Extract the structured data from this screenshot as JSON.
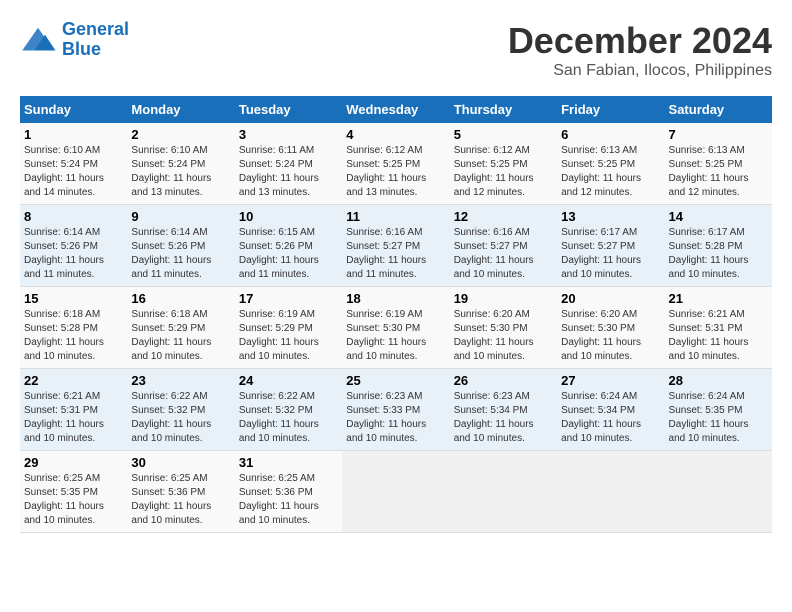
{
  "logo": {
    "line1": "General",
    "line2": "Blue"
  },
  "title": {
    "month": "December 2024",
    "location": "San Fabian, Ilocos, Philippines"
  },
  "headers": [
    "Sunday",
    "Monday",
    "Tuesday",
    "Wednesday",
    "Thursday",
    "Friday",
    "Saturday"
  ],
  "weeks": [
    [
      {
        "day": "1",
        "info": "Sunrise: 6:10 AM\nSunset: 5:24 PM\nDaylight: 11 hours\nand 14 minutes."
      },
      {
        "day": "2",
        "info": "Sunrise: 6:10 AM\nSunset: 5:24 PM\nDaylight: 11 hours\nand 13 minutes."
      },
      {
        "day": "3",
        "info": "Sunrise: 6:11 AM\nSunset: 5:24 PM\nDaylight: 11 hours\nand 13 minutes."
      },
      {
        "day": "4",
        "info": "Sunrise: 6:12 AM\nSunset: 5:25 PM\nDaylight: 11 hours\nand 13 minutes."
      },
      {
        "day": "5",
        "info": "Sunrise: 6:12 AM\nSunset: 5:25 PM\nDaylight: 11 hours\nand 12 minutes."
      },
      {
        "day": "6",
        "info": "Sunrise: 6:13 AM\nSunset: 5:25 PM\nDaylight: 11 hours\nand 12 minutes."
      },
      {
        "day": "7",
        "info": "Sunrise: 6:13 AM\nSunset: 5:25 PM\nDaylight: 11 hours\nand 12 minutes."
      }
    ],
    [
      {
        "day": "8",
        "info": "Sunrise: 6:14 AM\nSunset: 5:26 PM\nDaylight: 11 hours\nand 11 minutes."
      },
      {
        "day": "9",
        "info": "Sunrise: 6:14 AM\nSunset: 5:26 PM\nDaylight: 11 hours\nand 11 minutes."
      },
      {
        "day": "10",
        "info": "Sunrise: 6:15 AM\nSunset: 5:26 PM\nDaylight: 11 hours\nand 11 minutes."
      },
      {
        "day": "11",
        "info": "Sunrise: 6:16 AM\nSunset: 5:27 PM\nDaylight: 11 hours\nand 11 minutes."
      },
      {
        "day": "12",
        "info": "Sunrise: 6:16 AM\nSunset: 5:27 PM\nDaylight: 11 hours\nand 10 minutes."
      },
      {
        "day": "13",
        "info": "Sunrise: 6:17 AM\nSunset: 5:27 PM\nDaylight: 11 hours\nand 10 minutes."
      },
      {
        "day": "14",
        "info": "Sunrise: 6:17 AM\nSunset: 5:28 PM\nDaylight: 11 hours\nand 10 minutes."
      }
    ],
    [
      {
        "day": "15",
        "info": "Sunrise: 6:18 AM\nSunset: 5:28 PM\nDaylight: 11 hours\nand 10 minutes."
      },
      {
        "day": "16",
        "info": "Sunrise: 6:18 AM\nSunset: 5:29 PM\nDaylight: 11 hours\nand 10 minutes."
      },
      {
        "day": "17",
        "info": "Sunrise: 6:19 AM\nSunset: 5:29 PM\nDaylight: 11 hours\nand 10 minutes."
      },
      {
        "day": "18",
        "info": "Sunrise: 6:19 AM\nSunset: 5:30 PM\nDaylight: 11 hours\nand 10 minutes."
      },
      {
        "day": "19",
        "info": "Sunrise: 6:20 AM\nSunset: 5:30 PM\nDaylight: 11 hours\nand 10 minutes."
      },
      {
        "day": "20",
        "info": "Sunrise: 6:20 AM\nSunset: 5:30 PM\nDaylight: 11 hours\nand 10 minutes."
      },
      {
        "day": "21",
        "info": "Sunrise: 6:21 AM\nSunset: 5:31 PM\nDaylight: 11 hours\nand 10 minutes."
      }
    ],
    [
      {
        "day": "22",
        "info": "Sunrise: 6:21 AM\nSunset: 5:31 PM\nDaylight: 11 hours\nand 10 minutes."
      },
      {
        "day": "23",
        "info": "Sunrise: 6:22 AM\nSunset: 5:32 PM\nDaylight: 11 hours\nand 10 minutes."
      },
      {
        "day": "24",
        "info": "Sunrise: 6:22 AM\nSunset: 5:32 PM\nDaylight: 11 hours\nand 10 minutes."
      },
      {
        "day": "25",
        "info": "Sunrise: 6:23 AM\nSunset: 5:33 PM\nDaylight: 11 hours\nand 10 minutes."
      },
      {
        "day": "26",
        "info": "Sunrise: 6:23 AM\nSunset: 5:34 PM\nDaylight: 11 hours\nand 10 minutes."
      },
      {
        "day": "27",
        "info": "Sunrise: 6:24 AM\nSunset: 5:34 PM\nDaylight: 11 hours\nand 10 minutes."
      },
      {
        "day": "28",
        "info": "Sunrise: 6:24 AM\nSunset: 5:35 PM\nDaylight: 11 hours\nand 10 minutes."
      }
    ],
    [
      {
        "day": "29",
        "info": "Sunrise: 6:25 AM\nSunset: 5:35 PM\nDaylight: 11 hours\nand 10 minutes."
      },
      {
        "day": "30",
        "info": "Sunrise: 6:25 AM\nSunset: 5:36 PM\nDaylight: 11 hours\nand 10 minutes."
      },
      {
        "day": "31",
        "info": "Sunrise: 6:25 AM\nSunset: 5:36 PM\nDaylight: 11 hours\nand 10 minutes."
      },
      null,
      null,
      null,
      null
    ]
  ]
}
